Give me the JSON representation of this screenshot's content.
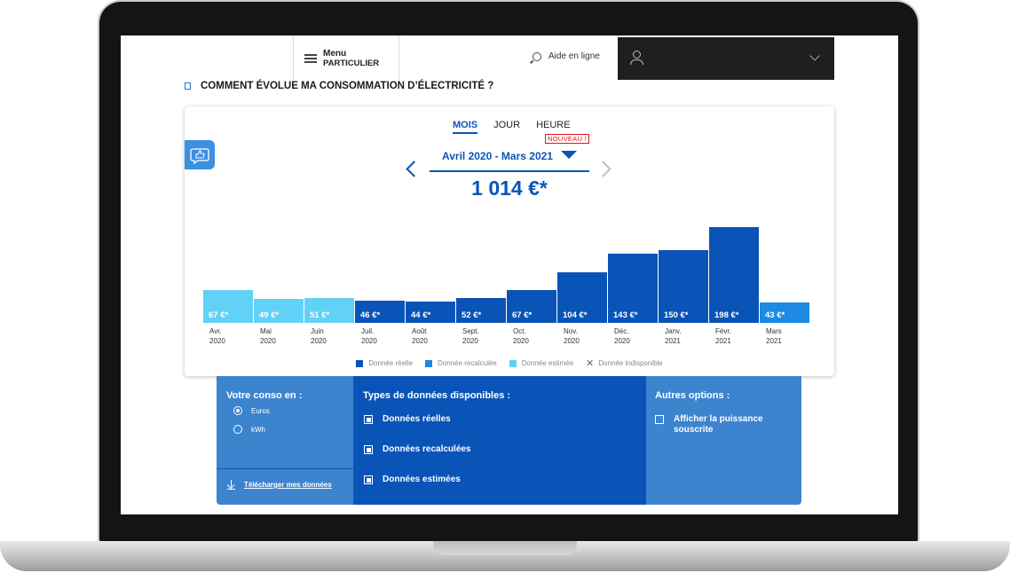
{
  "header": {
    "menu_label": "Menu",
    "menu_sublabel": "PARTICULIER",
    "help_label": "Aide en ligne"
  },
  "section_title": "COMMENT ÉVOLUE MA CONSOMMATION D’ÉLECTRICITÉ ?",
  "tabs": [
    {
      "label": "MOIS",
      "active": true
    },
    {
      "label": "JOUR",
      "active": false
    },
    {
      "label": "HEURE",
      "active": false
    }
  ],
  "new_badge": "NOUVEAU !",
  "period_label": "Avril 2020 - Mars 2021",
  "total": "1 014 €*",
  "colors": {
    "reelle": "#0a54b8",
    "recalculee": "#1c8ae3",
    "estimee": "#62d1f7",
    "accent": "#0a54b8"
  },
  "chart_data": {
    "type": "bar",
    "unit": "€",
    "categories": [
      {
        "month": "Avr.",
        "year": "2020"
      },
      {
        "month": "Mai",
        "year": "2020"
      },
      {
        "month": "Juin",
        "year": "2020"
      },
      {
        "month": "Juil.",
        "year": "2020"
      },
      {
        "month": "Août",
        "year": "2020"
      },
      {
        "month": "Sept.",
        "year": "2020"
      },
      {
        "month": "Oct.",
        "year": "2020"
      },
      {
        "month": "Nov.",
        "year": "2020"
      },
      {
        "month": "Déc.",
        "year": "2020"
      },
      {
        "month": "Janv.",
        "year": "2021"
      },
      {
        "month": "Févr.",
        "year": "2021"
      },
      {
        "month": "Mars",
        "year": "2021"
      }
    ],
    "values": [
      67,
      49,
      51,
      46,
      44,
      52,
      67,
      104,
      143,
      150,
      198,
      43
    ],
    "labels": [
      "67 €*",
      "49 €*",
      "51 €*",
      "46 €*",
      "44 €*",
      "52 €*",
      "67 €*",
      "104 €*",
      "143 €*",
      "150 €*",
      "198 €*",
      "43 €*"
    ],
    "data_types": [
      "estimee",
      "estimee",
      "estimee",
      "reelle",
      "reelle",
      "reelle",
      "reelle",
      "reelle",
      "reelle",
      "reelle",
      "reelle",
      "recalculee"
    ],
    "ylim": [
      0,
      198
    ],
    "legend": [
      {
        "key": "reelle",
        "label": "Donnée réelle"
      },
      {
        "key": "recalculee",
        "label": "Donnée recalculée"
      },
      {
        "key": "estimee",
        "label": "Donnée estimée"
      },
      {
        "key": "indisponible",
        "label": "Donnée indisponible"
      }
    ]
  },
  "options": {
    "conso_title": "Votre conso en :",
    "unit_options": [
      {
        "label": "Euros",
        "selected": true
      },
      {
        "label": "kWh",
        "selected": false
      }
    ],
    "download_label": "Télécharger mes données",
    "types_title": "Types de données disponibles :",
    "types": [
      {
        "label": "Données réelles",
        "checked": true
      },
      {
        "label": "Données recalculées",
        "checked": true
      },
      {
        "label": "Données estimées",
        "checked": true
      }
    ],
    "other_title": "Autres options :",
    "other": [
      {
        "label": "Afficher la puissance souscrite",
        "checked": false
      }
    ]
  }
}
